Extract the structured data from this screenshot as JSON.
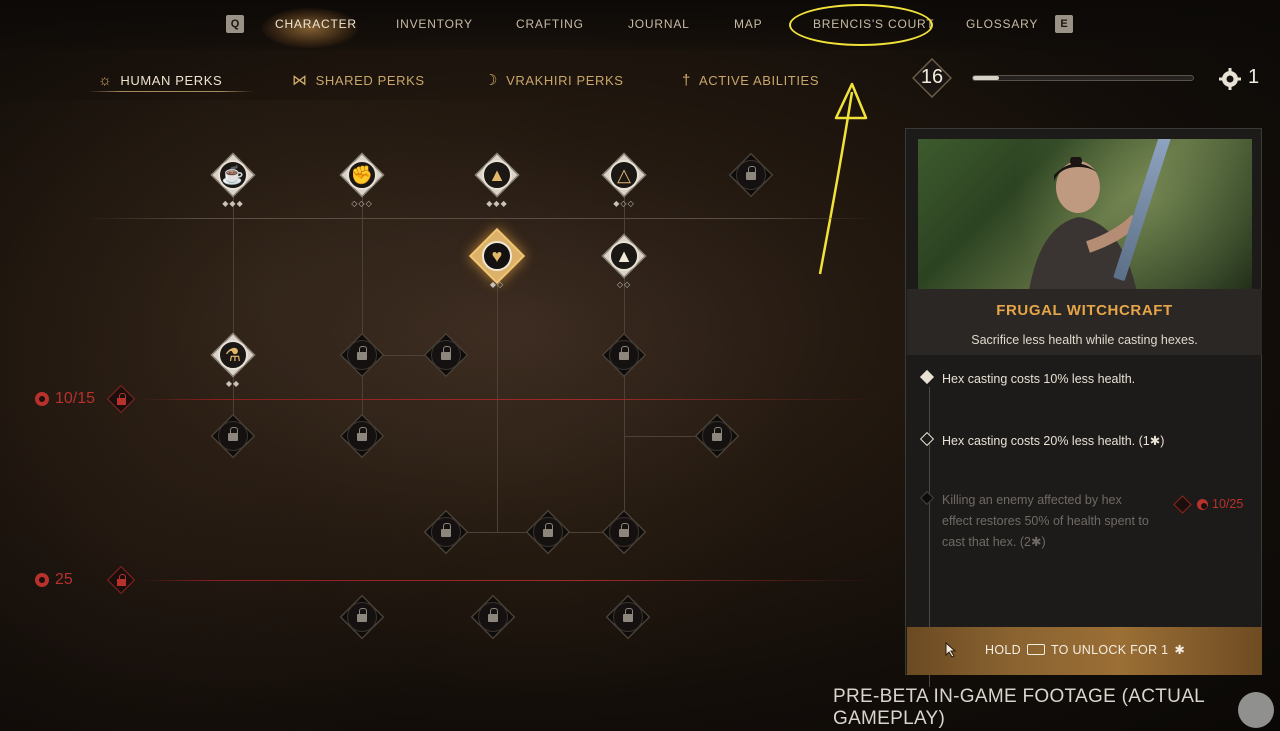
{
  "nav": {
    "left_key": "Q",
    "right_key": "E",
    "items": [
      "CHARACTER",
      "INVENTORY",
      "CRAFTING",
      "JOURNAL",
      "MAP",
      "BRENCIS'S COURT",
      "GLOSSARY"
    ]
  },
  "subtabs": [
    {
      "label": "HUMAN PERKS",
      "icon": "sun-icon"
    },
    {
      "label": "SHARED PERKS",
      "icon": "infinity-icon"
    },
    {
      "label": "VRAKHIRI PERKS",
      "icon": "crescent-icon"
    },
    {
      "label": "ACTIVE ABILITIES",
      "icon": "dagger-icon"
    }
  ],
  "status": {
    "level": "16",
    "xp_fraction": 0.12,
    "perk_points": "1"
  },
  "tiers": [
    {
      "label": "10/15"
    },
    {
      "label": "25"
    }
  ],
  "perk_panel": {
    "title": "FRUGAL WITCHCRAFT",
    "description": "Sacrifice less health while casting hexes.",
    "ranks": [
      {
        "text": "Hex casting costs 10% less health.",
        "state": "unlocked"
      },
      {
        "text": "Hex casting costs 20% less health.",
        "cost": "(1",
        "state": "available"
      },
      {
        "text": "Killing an enemy affected by hex effect restores 50% of health spent to cast that hex.",
        "cost": "(2",
        "state": "locked"
      }
    ],
    "rank3_requirement": "10/25",
    "hold_prefix": "HOLD",
    "hold_suffix": "TO UNLOCK FOR 1"
  },
  "footer": {
    "footage_label": "PRE-BETA IN-GAME FOOTAGE (ACTUAL GAMEPLAY)"
  },
  "colors": {
    "accent_gold": "#e6a548",
    "tier_red": "#b8312c",
    "annotation_yellow": "#f1e23a"
  }
}
